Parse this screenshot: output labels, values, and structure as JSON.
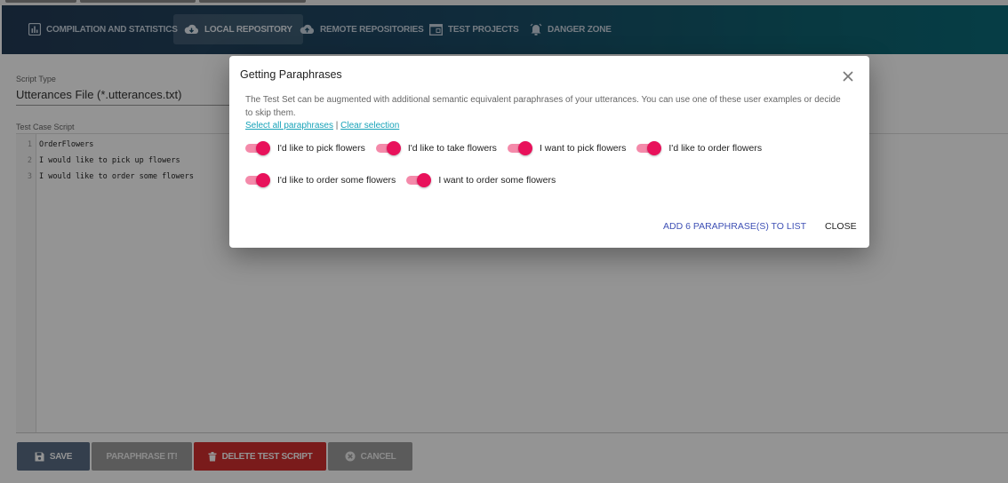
{
  "nav": {
    "items": [
      {
        "label": "COMPILATION AND STATISTICS",
        "icon": "bar-chart-icon"
      },
      {
        "label": "LOCAL REPOSITORY",
        "icon": "cloud-download-icon",
        "active": true
      },
      {
        "label": "REMOTE REPOSITORIES",
        "icon": "cloud-upload-icon"
      },
      {
        "label": "TEST PROJECTS",
        "icon": "window-icon"
      },
      {
        "label": "DANGER ZONE",
        "icon": "alarm-bell-icon"
      }
    ]
  },
  "form": {
    "script_type_label": "Script Type",
    "script_type_value": "Utterances File (*.utterances.txt)",
    "script_label": "Test Case Script",
    "lines": [
      {
        "n": "1",
        "text": "OrderFlowers"
      },
      {
        "n": "2",
        "text": "I would like to pick up flowers"
      },
      {
        "n": "3",
        "text": "I would like to order some flowers"
      }
    ]
  },
  "buttons": {
    "save": "SAVE",
    "paraphrase": "PARAPHRASE IT!",
    "delete": "DELETE TEST SCRIPT",
    "cancel": "CANCEL"
  },
  "dialog": {
    "title": "Getting Paraphrases",
    "description": "The Test Set can be augmented with additional semantic equivalent paraphrases of your utterances. You can use one of these user examples or decide to skip them.",
    "select_all": "Select all paraphrases",
    "separator": "|",
    "clear_selection": "Clear selection",
    "paraphrases": [
      "I'd like to pick flowers",
      "I'd like to take flowers",
      "I want to pick flowers",
      "I'd like to order flowers",
      "I'd like to order some flowers",
      "I want to order some flowers"
    ],
    "add_button": "ADD 6 PARAPHRASE(S) TO LIST",
    "close_button": "CLOSE"
  },
  "colors": {
    "toggle_on": "#e8125b",
    "link": "#17a2b8",
    "action_blue": "#3f51b5",
    "save_btn": "#5a6d86",
    "delete_btn": "#d32f2f"
  }
}
